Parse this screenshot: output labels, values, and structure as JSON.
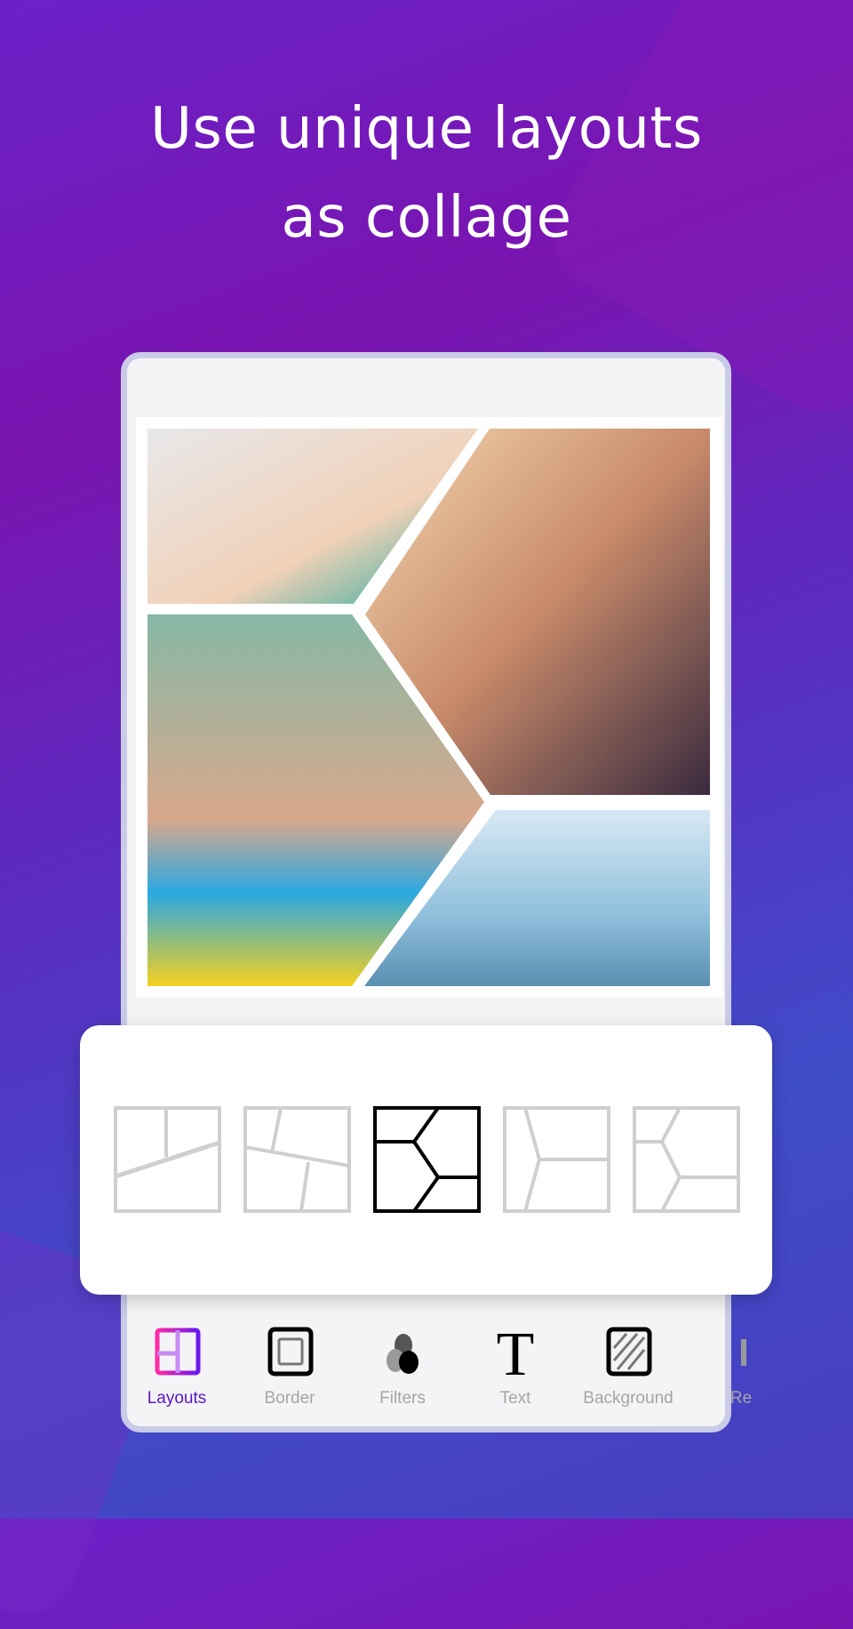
{
  "headline": {
    "line1": "Use unique layouts",
    "line2": "as collage"
  },
  "colors": {
    "accent": "#5a17c4",
    "active_icon_gradient": [
      "#ff2aa6",
      "#6a17f0"
    ],
    "inactive_label": "#a5a5a5"
  },
  "layouts": {
    "selected_index": 2,
    "items": [
      "layout-1",
      "layout-2",
      "layout-3",
      "layout-4",
      "layout-5"
    ]
  },
  "toolbar": {
    "items": [
      {
        "label": "Layouts",
        "icon": "layouts-icon",
        "active": true
      },
      {
        "label": "Border",
        "icon": "border-icon"
      },
      {
        "label": "Filters",
        "icon": "filters-icon"
      },
      {
        "label": "Text",
        "icon": "text-icon"
      },
      {
        "label": "Background",
        "icon": "background-icon"
      },
      {
        "label": "Re",
        "icon": "partial-icon"
      }
    ]
  }
}
